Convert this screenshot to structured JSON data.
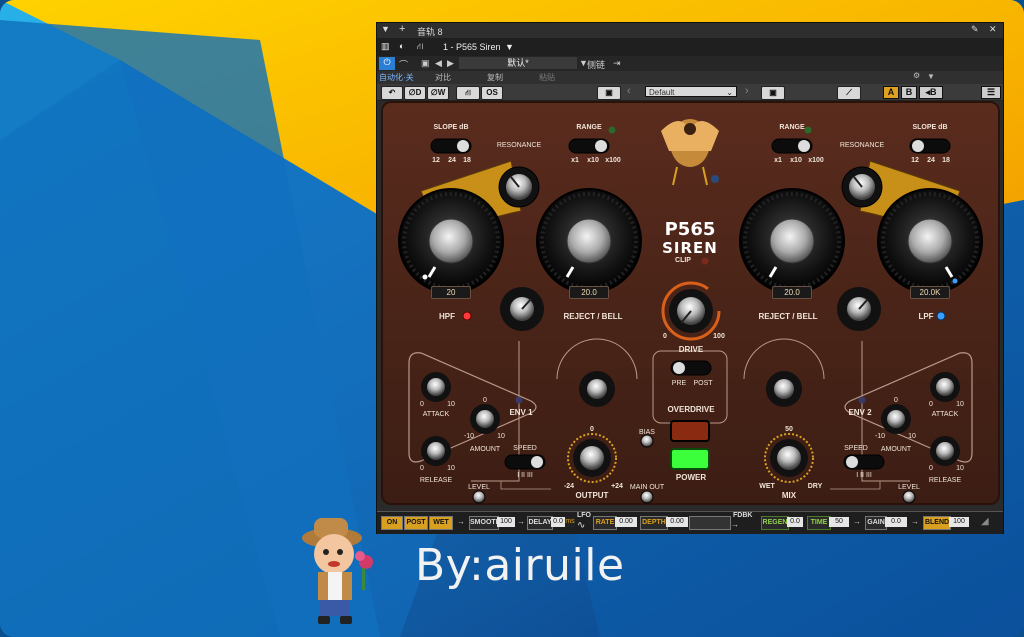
{
  "host": {
    "track_title": "音轨 8",
    "plugin_slot": "1 - P565 Siren",
    "preset_default": "默认*",
    "compare_label": "侧链",
    "auto_off": "自动化·关",
    "compare": "对比",
    "copy": "复制",
    "paste": "粘贴"
  },
  "plugin_toolbar": {
    "d_label": "D",
    "w_label": "W",
    "os_label": "OS",
    "preset_name": "Default",
    "a_label": "A",
    "b_label": "B",
    "ab_copy_label": "B"
  },
  "plugin": {
    "brand_model": "P565",
    "brand_name": "SIREN",
    "left": {
      "slope_title": "SLOPE dB",
      "slope_options": [
        "12",
        "24",
        "18"
      ],
      "resonance": "RESONANCE",
      "range_title": "RANGE",
      "range_options": [
        "x1",
        "x10",
        "x100"
      ],
      "hpf_value": "20",
      "hpf_label": "HPF",
      "bell_value": "20.0",
      "bell_label": "REJECT / BELL"
    },
    "right": {
      "range_title": "RANGE",
      "range_options": [
        "x1",
        "x10",
        "x100"
      ],
      "slope_title": "SLOPE dB",
      "slope_options": [
        "12",
        "24",
        "18"
      ],
      "resonance": "RESONANCE",
      "bell_value": "20.0",
      "bell_label": "REJECT / BELL",
      "lpf_value": "20.0K",
      "lpf_label": "LPF"
    },
    "clip": "CLIP",
    "drive_scale_min": "0",
    "drive_scale_max": "100",
    "drive": "DRIVE",
    "drive_pre": "PRE",
    "drive_post": "POST",
    "overdrive": "OVERDRIVE",
    "power": "POWER",
    "bias": "BIAS",
    "main_out": "MAIN OUT",
    "output": "OUTPUT",
    "output_min": "-24",
    "output_mid": "0",
    "output_max": "+24",
    "mix": "MIX",
    "mix_mid": "50",
    "mix_wet": "WET",
    "mix_dry": "DRY",
    "env1": {
      "title": "ENV 1",
      "attack": "ATTACK",
      "release": "RELEASE",
      "amount": "AMOUNT",
      "scale_0": "0",
      "scale_10": "10",
      "scale_m10": "-10",
      "level": "LEVEL",
      "speed": "SPEED",
      "speed_opts": "I  II  III"
    },
    "env2": {
      "title": "ENV 2",
      "attack": "ATTACK",
      "release": "RELEASE",
      "amount": "AMOUNT",
      "scale_0": "0",
      "scale_10": "10",
      "scale_m10": "-10",
      "level": "LEVEL",
      "speed": "SPEED",
      "speed_opts": "I  II  III"
    }
  },
  "bottom_bar": {
    "on": "ON",
    "post": "POST",
    "wet": "WET",
    "smooth": "SMOOTH",
    "smooth_val": "100",
    "delay": "DELAY",
    "delay_val": "0.0",
    "delay_unit": "ms",
    "lfo": "LFO",
    "rate": "RATE",
    "rate_val": "0.00",
    "depth": "DEPTH",
    "depth_val": "0.00",
    "fdbk": "FDBK",
    "regen": "REGEN",
    "regen_val": "0.0",
    "time": "TIME",
    "time_val": "50",
    "gain": "GAIN",
    "gain_val": "0.0",
    "blend": "BLEND",
    "blend_val": "100"
  },
  "byline": "By:airuile",
  "colors": {
    "panel": "#4a2418",
    "gold": "#d9a020",
    "power_green": "#3cff3c",
    "hpf_led": "#ff3a3a",
    "lpf_led": "#3aa0ff"
  }
}
